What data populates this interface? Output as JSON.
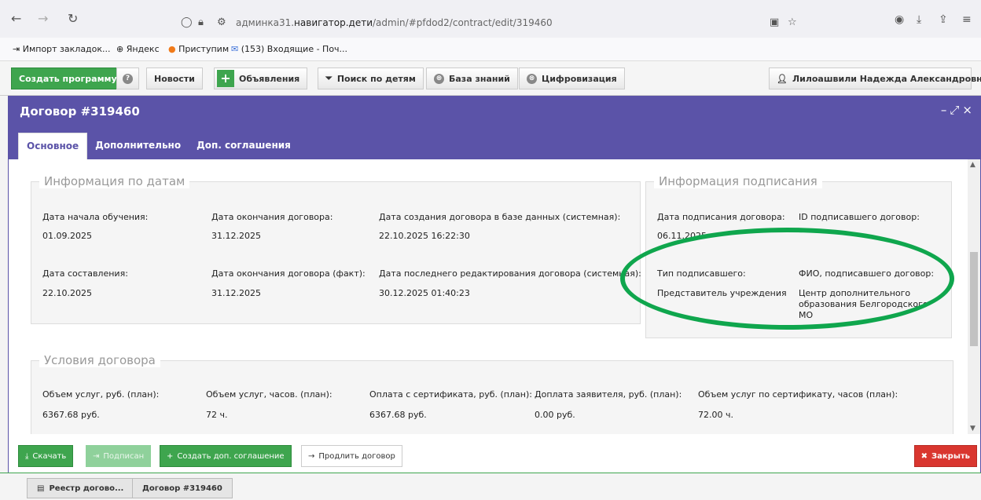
{
  "browser": {
    "url_prefix": "админка31.",
    "url_domain": "навигатор.дети",
    "url_path": "/admin/#pfdod2/contract/edit/319460",
    "bookmarks": [
      "Импорт закладок...",
      "Яндекс",
      "Приступим",
      "(153) Входящие - Поч..."
    ]
  },
  "toolbar": {
    "create_program": "Создать программу",
    "news": "Новости",
    "announcements": "Объявления",
    "search_children": "Поиск по детям",
    "knowledge_base": "База знаний",
    "digitalization": "Цифровизация",
    "user": "Лилоашвили Надежда Александровна"
  },
  "dialog": {
    "title": "Договор #319460",
    "tabs": [
      "Основное",
      "Дополнительно",
      "Доп. соглашения"
    ],
    "dates_group": {
      "title": "Информация по датам",
      "study_start_label": "Дата начала обучения:",
      "study_start": "01.09.2025",
      "contract_end_label": "Дата окончания договора:",
      "contract_end": "31.12.2025",
      "created_db_label": "Дата создания договора в базе данных (системная):",
      "created_db": "22.10.2025 16:22:30",
      "compiled_label": "Дата составления:",
      "compiled": "22.10.2025",
      "end_fact_label": "Дата окончания договора (факт):",
      "end_fact": "31.12.2025",
      "last_edit_label": "Дата последнего редактирования договора (системная):",
      "last_edit": "30.12.2025 01:40:23"
    },
    "sign_group": {
      "title": "Информация подписания",
      "sign_date_label": "Дата подписания договора:",
      "sign_date": "06.11.2025",
      "signer_id_label": "ID подписавшего договор:",
      "signer_type_label": "Тип подписавшего:",
      "signer_type": "Представитель учреждения",
      "signer_name_label": "ФИО, подписавшего договор:",
      "signer_name": "Центр дополнительного образования Белгородского МО"
    },
    "terms_group": {
      "title": "Условия договора",
      "volume_rub_label": "Объем услуг, руб. (план):",
      "volume_rub": "6367.68 руб.",
      "volume_hours_label": "Объем услуг, часов. (план):",
      "volume_hours": "72 ч.",
      "cert_payment_label": "Оплата с сертификата, руб. (план):",
      "cert_payment": "6367.68 руб.",
      "applicant_payment_label": "Доплата заявителя, руб. (план):",
      "applicant_payment": "0.00 руб.",
      "cert_hours_label": "Объем услуг по сертификату, часов (план):",
      "cert_hours": "72.00 ч."
    },
    "footer": {
      "download": "Скачать",
      "signed": "Подписан",
      "create_addendum": "Создать доп. соглашение",
      "extend": "Продлить договор",
      "close": "Закрыть"
    }
  },
  "taskbar": [
    "Реестр догово...",
    "Договор #319460"
  ],
  "colors": {
    "header": "#5b53a8",
    "green": "#3ea54e",
    "red": "#d9362f",
    "ellipse": "#0fa64d"
  }
}
